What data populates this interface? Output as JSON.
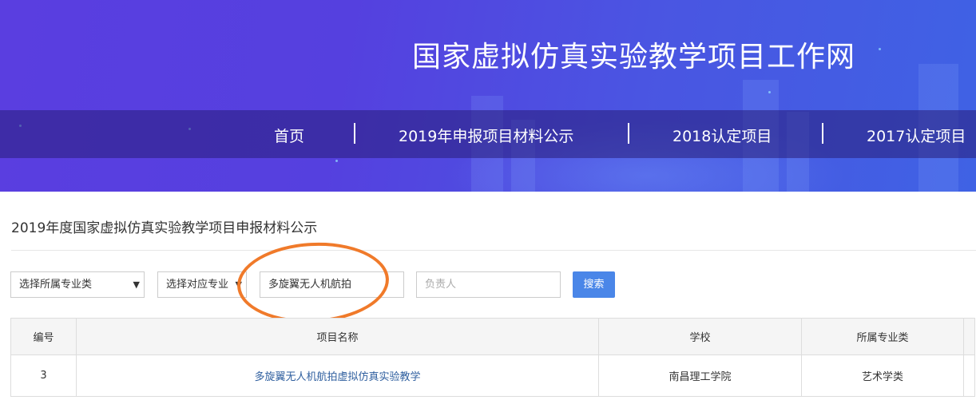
{
  "banner": {
    "site_title": "国家虚拟仿真实验教学项目工作网"
  },
  "nav": {
    "items": [
      "首页",
      "2019年申报项目材料公示",
      "2018认定项目",
      "2017认定项目"
    ]
  },
  "section": {
    "title": "2019年度国家虚拟仿真实验教学项目申报材料公示"
  },
  "filters": {
    "major_category": "选择所属专业类",
    "major": "选择对应专业",
    "project_name_value": "多旋翼无人机航拍",
    "leader_placeholder": "负责人",
    "search_label": "搜索"
  },
  "table": {
    "headers": [
      "编号",
      "项目名称",
      "学校",
      "所属专业类"
    ],
    "rows": [
      {
        "id": "3",
        "name": "多旋翼无人机航拍虚拟仿真实验教学",
        "school": "南昌理工学院",
        "category": "艺术学类"
      }
    ]
  },
  "colors": {
    "banner_start": "#5a3ee0",
    "banner_end": "#3f62e4",
    "search_button": "#4a86e8",
    "highlight": "#f07a2a",
    "link": "#2f5f9f"
  }
}
